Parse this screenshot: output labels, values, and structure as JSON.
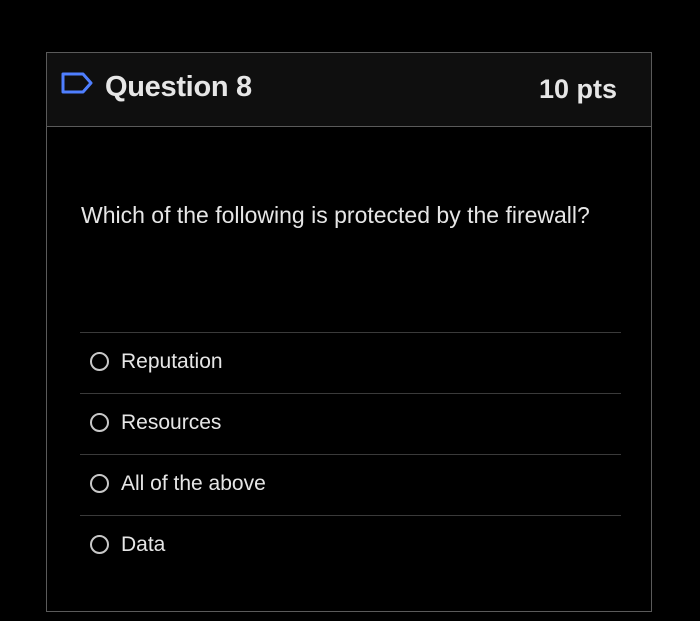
{
  "question": {
    "flag_icon": "flag-outline-icon",
    "title": "Question 8",
    "points": "10 pts",
    "text": "Which of the following is protected by the firewall?",
    "colors": {
      "background": "#000000",
      "header": "#0f0f0f",
      "border": "#5a5a5a",
      "text": "#e6e6e6",
      "flag": "#4f7fff"
    }
  },
  "answers": [
    {
      "label": "Reputation",
      "selected": false
    },
    {
      "label": "Resources",
      "selected": false
    },
    {
      "label": "All of the above",
      "selected": false
    },
    {
      "label": "Data",
      "selected": false
    }
  ]
}
